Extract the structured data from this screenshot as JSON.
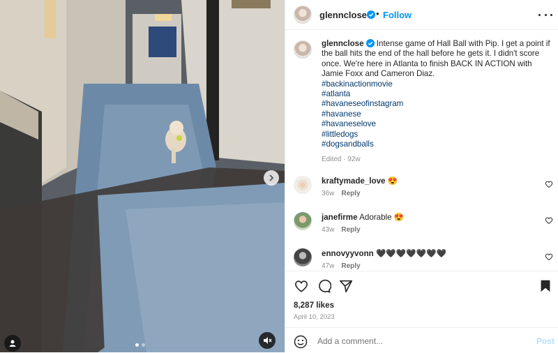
{
  "post": {
    "username": "glennclose",
    "follow_label": "Follow",
    "separator": "•",
    "caption_text": "Intense game of Hall Ball with Pip. I get a point if the ball hits the end of the hall before he gets it. I didn't score once. We're here in Atlanta to finish BACK IN ACTION with Jamie Foxx and Cameron Diaz.",
    "hashtags": [
      "#backinactionmovie",
      "#atlanta",
      "#havaneseofinstagram",
      "#havanese",
      "#havaneselove",
      "#littledogs",
      "#dogsandballs"
    ],
    "caption_meta": "Edited · 92w",
    "likes": "8,287 likes",
    "date": "April 10, 2023"
  },
  "comments": [
    {
      "username": "kraftymade_love",
      "text": "😍",
      "age": "36w",
      "reply": "Reply"
    },
    {
      "username": "janefirme",
      "text": "Adorable 😍",
      "age": "43w",
      "reply": "Reply"
    },
    {
      "username": "ennovyyvonn",
      "text": "🖤🖤🖤🖤🖤🖤🖤",
      "age": "47w",
      "reply": "Reply"
    }
  ],
  "comment_box": {
    "placeholder": "Add a comment...",
    "post_label": "Post"
  },
  "media": {
    "slide_count": 2,
    "active_slide": 1
  },
  "colors": {
    "accent": "#0095f6",
    "hashtag": "#00376b",
    "verified": "#0095f6"
  },
  "icons": [
    "verified-badge-icon",
    "more-options-icon",
    "next-arrow-icon",
    "tag-user-icon",
    "mute-icon",
    "heart-icon",
    "comment-icon",
    "share-icon",
    "bookmark-icon",
    "emoji-icon"
  ]
}
